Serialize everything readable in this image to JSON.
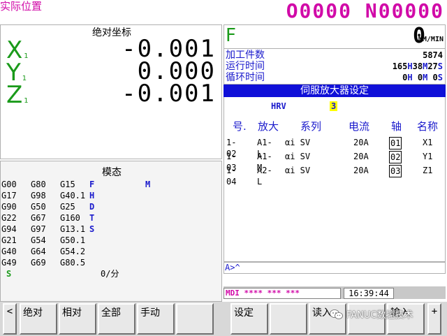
{
  "header": {
    "title": "实际位置",
    "program": "O0000 N00000"
  },
  "position": {
    "title": "绝对坐标",
    "axes": [
      {
        "name": "X",
        "sub": "1",
        "value": "-0.001"
      },
      {
        "name": "Y",
        "sub": "1",
        "value": "0.000"
      },
      {
        "name": "Z",
        "sub": "1",
        "value": "-0.001"
      }
    ]
  },
  "modal": {
    "title": "模态",
    "rows": [
      [
        "G00",
        "G80",
        "G15",
        "F",
        "M"
      ],
      [
        "G17",
        "G98",
        "G40.1",
        "H",
        ""
      ],
      [
        "G90",
        "G50",
        "G25",
        "D",
        ""
      ],
      [
        "G22",
        "G67",
        "G160",
        "T",
        ""
      ],
      [
        "G94",
        "G97",
        "G13.1",
        "S",
        ""
      ],
      [
        "G21",
        "G54",
        "G50.1",
        "",
        ""
      ],
      [
        "G40",
        "G64",
        "G54.2",
        "",
        ""
      ],
      [
        "G49",
        "G69",
        "G80.5",
        "",
        ""
      ]
    ],
    "s_label": "S",
    "rate": "0/分"
  },
  "info": {
    "feed_label": "F",
    "feed_value": "0",
    "feed_unit": "MM/MIN",
    "parts_label": "加工件数",
    "parts_value": "5874",
    "run_label": "运行时间",
    "run_h": "165",
    "run_m": "38",
    "run_s": "27",
    "cycle_label": "循环时间",
    "cycle_h": "0",
    "cycle_m": "0",
    "cycle_s": "0",
    "h": "H",
    "m": "M",
    "s": "S"
  },
  "servo": {
    "title": "伺服放大器设定",
    "hrv_label": "HRV",
    "hrv_value": "3",
    "columns": [
      "号.",
      "放大",
      "系列",
      "电流",
      "轴",
      "名称"
    ],
    "rows": [
      {
        "no": "1-02",
        "amp": "A1-L",
        "series": "αi SV",
        "current": "20A",
        "axis": "01",
        "name": "X1"
      },
      {
        "no": "1-03",
        "amp": "A1-M",
        "series": "αi SV",
        "current": "20A",
        "axis": "02",
        "name": "Y1"
      },
      {
        "no": "1-04",
        "amp": "A2-L",
        "series": "αi SV",
        "current": "20A",
        "axis": "03",
        "name": "Z1"
      }
    ]
  },
  "command_line": "A>^",
  "status": {
    "mode": "MDI  **** *** ***",
    "time": "16:39:44"
  },
  "softkeys": {
    "left_arrow": "<",
    "keys": [
      "绝对",
      "相对",
      "全部",
      "手动",
      "",
      "设定",
      "",
      "读入",
      "",
      "输入"
    ],
    "right_arrow": "+"
  },
  "watermark": "FANUC数控技术"
}
